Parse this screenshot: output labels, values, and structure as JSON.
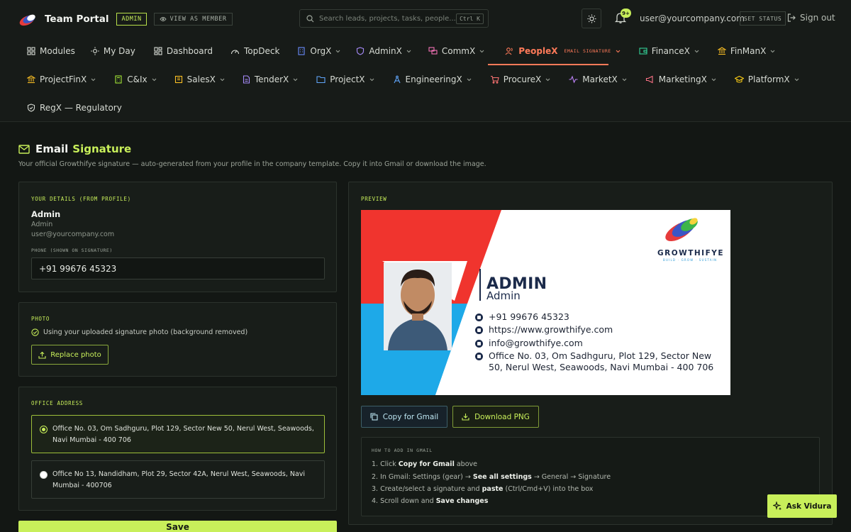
{
  "header": {
    "brand": "Team Portal",
    "role_badge": "ADMIN",
    "view_as": "VIEW AS MEMBER",
    "search_placeholder": "Search leads, projects, tasks, people...",
    "search_shortcut": "Ctrl K",
    "notifications_badge": "9+",
    "user_email": "user@yourcompany.com",
    "set_status": "SET STATUS",
    "sign_out": "Sign out"
  },
  "nav": {
    "row1": [
      {
        "label": "Modules",
        "icon": "grid-icon"
      },
      {
        "label": "My Day",
        "icon": "sun-icon"
      },
      {
        "label": "Dashboard",
        "icon": "dashboard-icon"
      },
      {
        "label": "TopDeck",
        "icon": "gauge-icon"
      },
      {
        "label": "OrgX",
        "icon": "building-icon"
      },
      {
        "label": "AdminX",
        "icon": "shield-icon"
      },
      {
        "label": "CommX",
        "icon": "chat-icon"
      },
      {
        "label": "PeopleX",
        "icon": "people-icon",
        "sub": "EMAIL SIGNATURE"
      },
      {
        "label": "FinanceX",
        "icon": "wallet-icon"
      },
      {
        "label": "FinManX",
        "icon": "bank-icon"
      }
    ],
    "row2": [
      {
        "label": "ProjectFinX",
        "icon": "bank-icon"
      },
      {
        "label": "C&Ix",
        "icon": "calculator-icon"
      },
      {
        "label": "SalesX",
        "icon": "receipt-icon"
      },
      {
        "label": "TenderX",
        "icon": "document-icon"
      },
      {
        "label": "ProjectX",
        "icon": "folder-icon"
      },
      {
        "label": "EngineeringX",
        "icon": "compass-icon"
      },
      {
        "label": "ProcureX",
        "icon": "cart-icon"
      },
      {
        "label": "MarketX",
        "icon": "pulse-icon"
      },
      {
        "label": "MarketingX",
        "icon": "megaphone-icon"
      },
      {
        "label": "PlatformX",
        "icon": "graduation-icon"
      }
    ],
    "row3": [
      {
        "label": "RegX — Regulatory",
        "icon": "shield-check-icon"
      }
    ]
  },
  "page": {
    "title_part1": "Email",
    "title_part2": "Signature",
    "subtitle": "Your official Growthifye signature — auto-generated from your profile in the company template. Copy it into Gmail or download the image."
  },
  "details": {
    "section_label": "YOUR DETAILS (FROM PROFILE)",
    "name": "Admin",
    "role": "Admin",
    "email": "user@yourcompany.com",
    "phone_label": "PHONE (SHOWN ON SIGNATURE)",
    "phone_value": "+91 99676 45323"
  },
  "photo": {
    "section_label": "PHOTO",
    "status": "Using your uploaded signature photo (background removed)",
    "replace_label": "Replace photo"
  },
  "office": {
    "section_label": "OFFICE ADDRESS",
    "options": [
      {
        "text": "Office No. 03, Om Sadhguru, Plot 129, Sector New 50, Nerul West, Seawoods, Navi Mumbai - 400 706",
        "selected": true
      },
      {
        "text": "Office No 13, Nandidham, Plot 29, Sector 42A, Nerul West, Seawoods, Navi Mumbai - 400706",
        "selected": false
      }
    ]
  },
  "preview": {
    "section_label": "PREVIEW",
    "sig_name": "ADMIN",
    "sig_role": "Admin",
    "sig_phone": "+91 99676 45323",
    "sig_website": "https://www.growthifye.com",
    "sig_email": "info@growthifye.com",
    "sig_address_l1": "Office No. 03, Om Sadhguru, Plot 129, Sector New",
    "sig_address_l2": "50, Nerul West, Seawoods, Navi Mumbai - 400 706",
    "company_word": "GROWTHIFYE",
    "company_tagline": "BUILD · GROW · SUSTAIN",
    "copy_label": "Copy for Gmail",
    "download_label": "Download PNG"
  },
  "howto": {
    "title": "HOW TO ADD IN GMAIL",
    "s1_pre": "1. Click ",
    "s1_b": "Copy for Gmail",
    "s1_post": " above",
    "s2_pre": "2. In Gmail: Settings (gear) → ",
    "s2_b": "See all settings",
    "s2_post": " → General → Signature",
    "s3_pre": "3. Create/select a signature and ",
    "s3_b": "paste",
    "s3_post": " (Ctrl/Cmd+V) into the box",
    "s4_pre": "4. Scroll down and ",
    "s4_b": "Save changes",
    "s4_post": ""
  },
  "save_label": "Save",
  "ask_label": "Ask Vidura",
  "colors": {
    "accent": "#c8ef5a",
    "active_nav": "#ff7a59",
    "background": "#131714",
    "panel": "#181d19"
  }
}
